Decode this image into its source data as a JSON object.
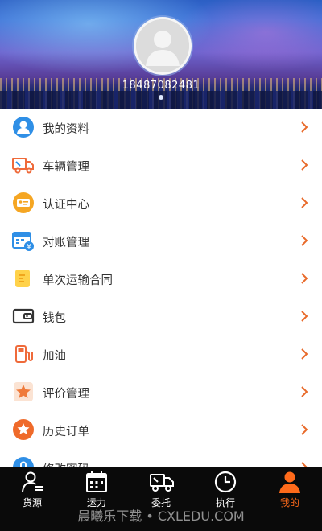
{
  "profile": {
    "phone": "18487082481"
  },
  "menu": {
    "items": [
      {
        "label": "我的资料",
        "icon": "user-profile-icon"
      },
      {
        "label": "车辆管理",
        "icon": "truck-icon"
      },
      {
        "label": "认证中心",
        "icon": "id-card-icon"
      },
      {
        "label": "对账管理",
        "icon": "calendar-bill-icon"
      },
      {
        "label": "单次运输合同",
        "icon": "contract-icon"
      },
      {
        "label": "钱包",
        "icon": "wallet-icon"
      },
      {
        "label": "加油",
        "icon": "fuel-pump-icon"
      },
      {
        "label": "评价管理",
        "icon": "star-rating-icon"
      },
      {
        "label": "历史订单",
        "icon": "star-badge-icon"
      },
      {
        "label": "修改密码",
        "icon": "lock-icon"
      }
    ]
  },
  "tabbar": {
    "tabs": [
      {
        "label": "货源",
        "icon": "cargo-source-icon"
      },
      {
        "label": "运力",
        "icon": "calendar-icon"
      },
      {
        "label": "委托",
        "icon": "truck-outline-icon"
      },
      {
        "label": "执行",
        "icon": "clock-icon"
      },
      {
        "label": "我的",
        "icon": "person-icon",
        "active": true
      }
    ]
  },
  "watermark": "晨曦乐下载 • CXLEDU.COM",
  "colors": {
    "accent": "#ff6a1a",
    "blue": "#2f8fe6",
    "orange": "#f5a623",
    "tabbar_bg": "#0a0a0a"
  }
}
